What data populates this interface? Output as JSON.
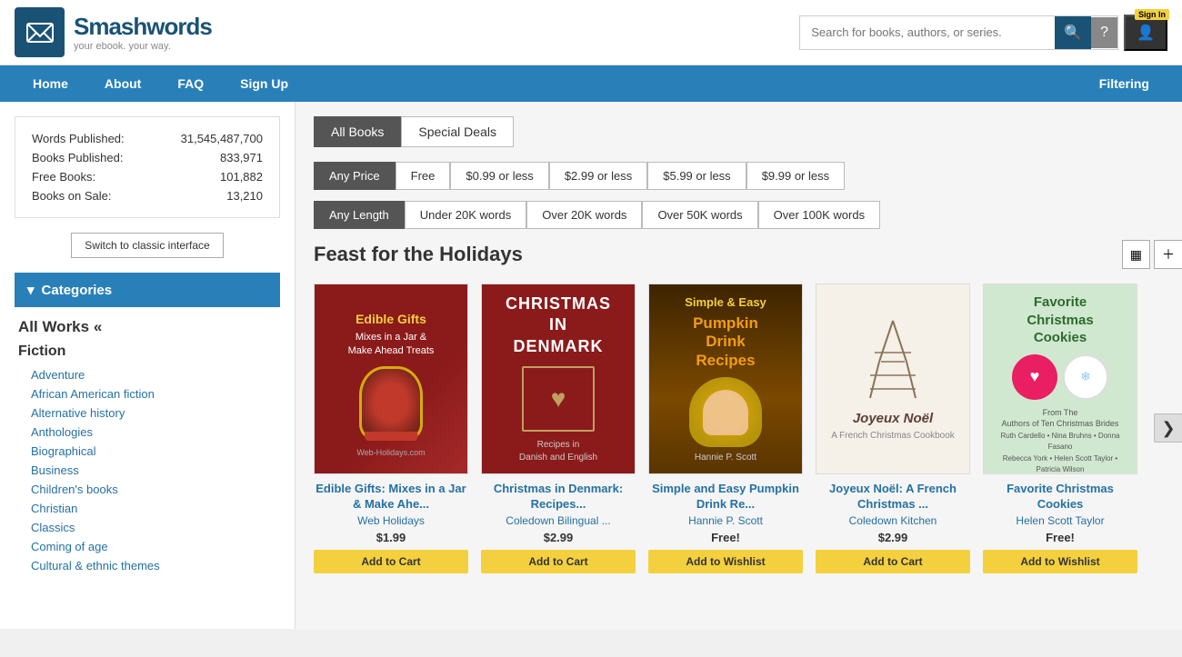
{
  "header": {
    "logo_title": "Smashwords",
    "logo_tagline": "your ebook. your way.",
    "search_placeholder": "Search for books, authors, or series.",
    "signin_label": "Sign In",
    "signin_badge": "Sign In"
  },
  "nav": {
    "items": [
      {
        "label": "Home",
        "href": "#"
      },
      {
        "label": "About",
        "href": "#"
      },
      {
        "label": "FAQ",
        "href": "#"
      },
      {
        "label": "Sign Up",
        "href": "#"
      }
    ],
    "right_label": "Filtering"
  },
  "sidebar": {
    "stats": [
      {
        "label": "Words Published:",
        "value": "31,545,487,700"
      },
      {
        "label": "Books Published:",
        "value": "833,971"
      },
      {
        "label": "Free Books:",
        "value": "101,882"
      },
      {
        "label": "Books on Sale:",
        "value": "13,210"
      }
    ],
    "switch_btn": "Switch to classic interface",
    "categories_label": "Categories",
    "all_works": "All Works «",
    "section_fiction": "Fiction",
    "categories": [
      "Adventure",
      "African American fiction",
      "Alternative history",
      "Anthologies",
      "Biographical",
      "Business",
      "Children's books",
      "Christian",
      "Classics",
      "Coming of age",
      "Cultural & ethnic themes"
    ]
  },
  "tabs": [
    {
      "label": "All Books",
      "active": true
    },
    {
      "label": "Special Deals",
      "active": false
    }
  ],
  "price_filters": [
    {
      "label": "Any Price",
      "active": true
    },
    {
      "label": "Free",
      "active": false
    },
    {
      "label": "$0.99 or less",
      "active": false
    },
    {
      "label": "$2.99 or less",
      "active": false
    },
    {
      "label": "$5.99 or less",
      "active": false
    },
    {
      "label": "$9.99 or less",
      "active": false
    }
  ],
  "length_filters": [
    {
      "label": "Any Length",
      "active": true
    },
    {
      "label": "Under 20K words",
      "active": false
    },
    {
      "label": "Over 20K words",
      "active": false
    },
    {
      "label": "Over 50K words",
      "active": false
    },
    {
      "label": "Over 100K words",
      "active": false
    }
  ],
  "section_title": "Feast for the Holidays",
  "books": [
    {
      "title": "Edible Gifts: Mixes in a Jar & Make Ahe...",
      "author": "Web Holidays",
      "price": "$1.99",
      "btn_label": "Add to Cart",
      "cover_type": "edible",
      "cover_line1": "Edible Gifts",
      "cover_line2": "Mixes in a Jar &",
      "cover_line3": "Make Ahead Treats"
    },
    {
      "title": "Christmas in Denmark: Recipes...",
      "author": "Coledown Bilingual ...",
      "price": "$2.99",
      "btn_label": "Add to Cart",
      "cover_type": "denmark",
      "cover_line1": "CHRISTMAS",
      "cover_line2": "IN",
      "cover_line3": "DENMARK"
    },
    {
      "title": "Simple and Easy Pumpkin Drink Re...",
      "author": "Hannie P. Scott",
      "price": "Free!",
      "btn_label": "Add to Wishlist",
      "cover_type": "pumpkin",
      "cover_line1": "Simple & Easy",
      "cover_line2": "Pumpkin",
      "cover_line3": "Drink",
      "cover_line4": "Recipes"
    },
    {
      "title": "Joyeux Noël: A French Christmas ...",
      "author": "Coledown Kitchen",
      "price": "$2.99",
      "btn_label": "Add to Cart",
      "cover_type": "joyeux",
      "cover_line1": "Joyeux Noël",
      "cover_line2": "A French Christmas Cookbook"
    },
    {
      "title": "Favorite Christmas Cookies",
      "author": "Helen Scott Taylor",
      "price": "Free!",
      "btn_label": "Add to Wishlist",
      "cover_type": "favorite",
      "cover_line1": "Favorite",
      "cover_line2": "Christmas",
      "cover_line3": "Cookies"
    }
  ],
  "next_arrow": "❯"
}
